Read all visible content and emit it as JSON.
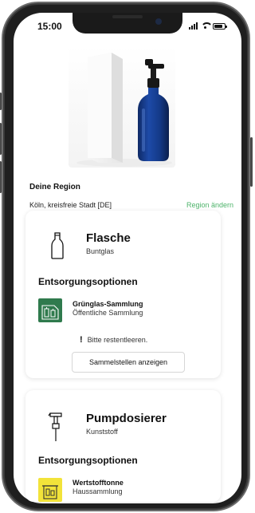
{
  "status_bar": {
    "time": "15:00"
  },
  "region": {
    "label": "Deine Region",
    "value": "Köln, kreisfreie Stadt [DE]",
    "change_label": "Region ändern"
  },
  "colors": {
    "accent": "#4db36a",
    "glass_icon_bg": "#2f7a4d",
    "yellow_bin_bg": "#f2e33a"
  },
  "components": [
    {
      "icon": "bottle-icon",
      "title": "Flasche",
      "material": "Buntglas",
      "options_heading": "Entsorgungsoptionen",
      "option": {
        "icon": "glass-container-icon",
        "title": "Grünglas-Sammlung",
        "subtitle": "Öffentliche Sammlung"
      },
      "hint": "Bitte restentleeren.",
      "hint_mark": "!",
      "button_label": "Sammelstellen anzeigen"
    },
    {
      "icon": "pump-dispenser-icon",
      "title": "Pumpdosierer",
      "material": "Kunststoff",
      "options_heading": "Entsorgungsoptionen",
      "option": {
        "icon": "yellow-bin-icon",
        "title": "Wertstofftonne",
        "subtitle": "Haussammlung"
      }
    }
  ]
}
